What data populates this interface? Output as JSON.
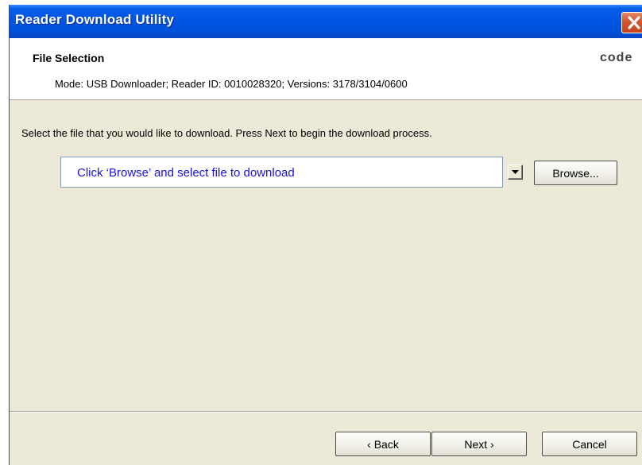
{
  "window": {
    "title": "Reader Download Utility",
    "close_icon": "close-icon"
  },
  "header": {
    "section_title": "File Selection",
    "logo_text": "code",
    "mode_line": "Mode: USB Downloader; Reader ID: 0010028320; Versions: 3178/3104/0600"
  },
  "main": {
    "instruction": "Select the file that you would like to download. Press Next to begin the download process.",
    "file_combo_value": "Click ‘Browse’ and select file to download",
    "browse_label": "Browse..."
  },
  "footer": {
    "back_label": "‹ Back",
    "next_label": "Next ›",
    "cancel_label": "Cancel"
  },
  "colors": {
    "titlebar": "#0054e3",
    "dialog_bg": "#ece9d8",
    "combo_text": "#1a10e0",
    "close_button": "#d45a34"
  }
}
